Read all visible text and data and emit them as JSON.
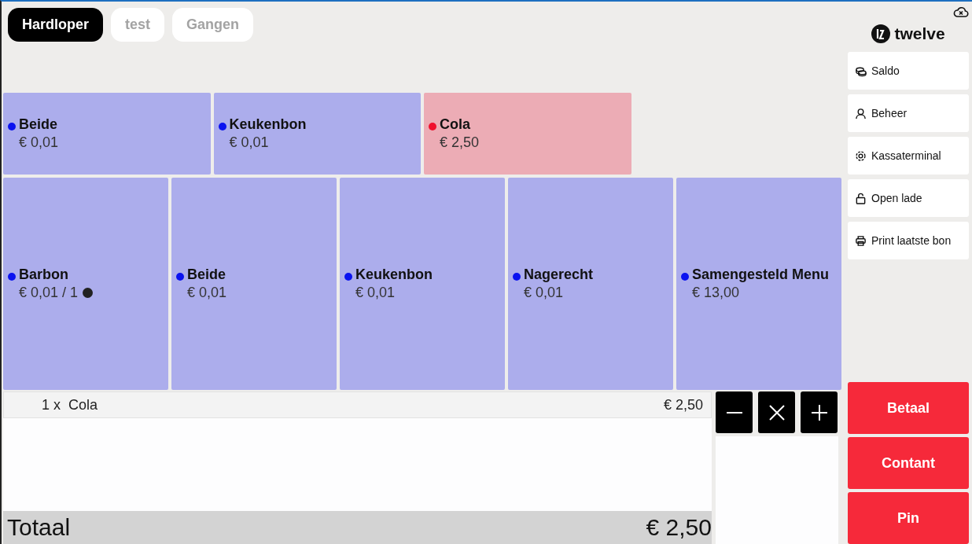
{
  "tabs": [
    {
      "label": "Hardloper",
      "selected": true
    },
    {
      "label": "test",
      "selected": false
    },
    {
      "label": "Gangen",
      "selected": false
    }
  ],
  "product_rows": [
    {
      "tiles": [
        {
          "name": "Beide",
          "price": "€ 0,01",
          "color": "#0a12f0"
        },
        {
          "name": "Keukenbon",
          "price": "€ 0,01",
          "color": "#0a12f0"
        },
        {
          "name": "Cola",
          "price": "€ 2,50",
          "color": "#f0102e"
        }
      ]
    },
    {
      "tiles": [
        {
          "name": "Barbon",
          "price": "€ 0,01 / 1",
          "color": "#0a12f0",
          "indicator": true
        },
        {
          "name": "Beide",
          "price": "€ 0,01",
          "color": "#0a12f0"
        },
        {
          "name": "Keukenbon",
          "price": "€ 0,01",
          "color": "#0a12f0"
        },
        {
          "name": "Nagerecht",
          "price": "€ 0,01",
          "color": "#0a12f0"
        },
        {
          "name": "Samengesteld Menu",
          "price": "€ 13,00",
          "color": "#0a12f0"
        }
      ]
    }
  ],
  "order": {
    "lines": [
      {
        "quantity": "1 x",
        "name": "Cola",
        "price": "€ 2,50"
      }
    ],
    "total_label": "Totaal",
    "total": "€ 2,50"
  },
  "quantity_buttons": [
    {
      "kind": "minus"
    },
    {
      "kind": "remove"
    },
    {
      "kind": "plus"
    }
  ],
  "sidebar": {
    "logo": "twelve",
    "menu": [
      {
        "label": "Saldo",
        "kind": "coins"
      },
      {
        "label": "Beheer",
        "kind": "user"
      },
      {
        "label": "Kassaterminal",
        "kind": "gear"
      },
      {
        "label": "Open lade",
        "kind": "lock"
      },
      {
        "label": "Print laatste bon",
        "kind": "printer"
      }
    ]
  },
  "payment_buttons": [
    "Betaal",
    "Contant",
    "Pin"
  ]
}
